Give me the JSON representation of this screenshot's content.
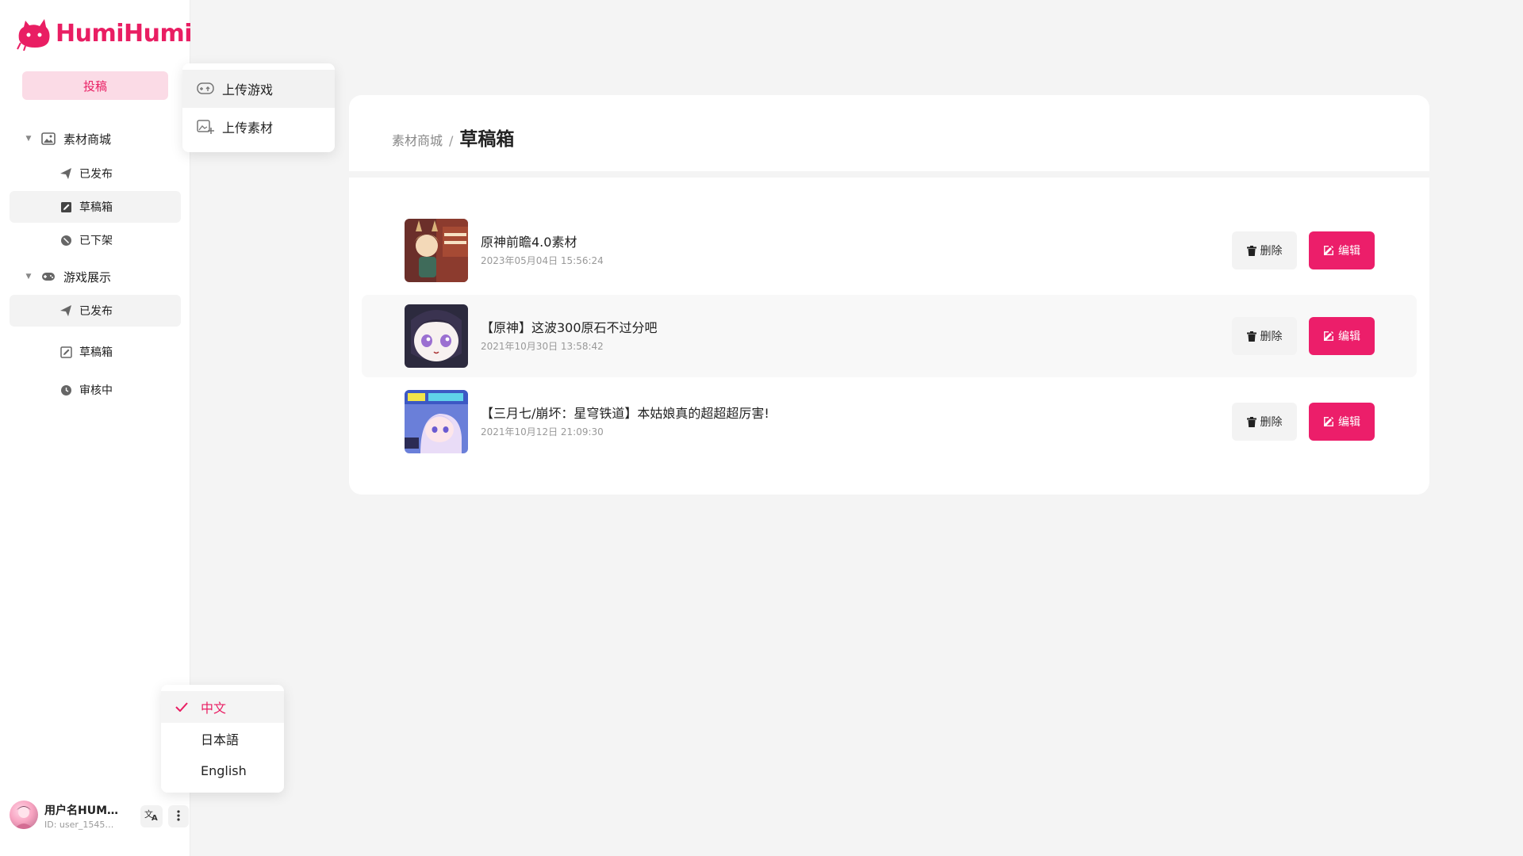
{
  "app": {
    "logo_text": "HumiHumi",
    "accent_color": "#e91e63"
  },
  "sidebar": {
    "submit_label": "投稿",
    "sections": [
      {
        "label": "素材商城",
        "icon": "image-gallery-icon",
        "items": [
          {
            "label": "已发布",
            "icon": "paper-plane-icon"
          },
          {
            "label": "草稿箱",
            "icon": "draft-edit-icon",
            "active": true
          },
          {
            "label": "已下架",
            "icon": "unavailable-icon"
          }
        ]
      },
      {
        "label": "游戏展示",
        "icon": "gamepad-icon",
        "items": [
          {
            "label": "已发布",
            "icon": "paper-plane-icon"
          },
          {
            "label": "草稿箱",
            "icon": "draft-edit-icon"
          },
          {
            "label": "审核中",
            "icon": "clock-icon"
          }
        ]
      }
    ]
  },
  "upload_menu": {
    "items": [
      {
        "label": "上传游戏",
        "icon": "upload-game-icon"
      },
      {
        "label": "上传素材",
        "icon": "upload-image-icon"
      }
    ]
  },
  "language_menu": {
    "items": [
      {
        "label": "中文",
        "selected": true
      },
      {
        "label": "日本語"
      },
      {
        "label": "English"
      }
    ]
  },
  "user": {
    "name": "用户名HUM…",
    "id": "ID: user_1545…"
  },
  "breadcrumb": {
    "parent": "素材商城",
    "separator": "/",
    "current": "草稿箱"
  },
  "drafts": [
    {
      "title": "原神前瞻4.0素材",
      "date": "2023年05月04日 15:56:24"
    },
    {
      "title": "【原神】这波300原石不过分吧",
      "date": "2021年10月30日 13:58:42"
    },
    {
      "title": "【三月七/崩坏：星穹铁道】本姑娘真的超超超厉害!",
      "date": "2021年10月12日 21:09:30"
    }
  ],
  "actions": {
    "delete_label": "删除",
    "edit_label": "编辑"
  }
}
